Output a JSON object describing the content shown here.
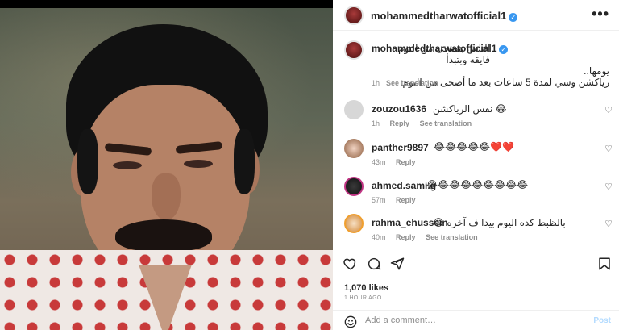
{
  "header": {
    "username": "mohammedtharwatofficial1",
    "more_label": "•••"
  },
  "caption": {
    "username": "mohammedtharwatofficial1",
    "line1": "الناس بتصحى من النوم فايقه وبتبدأ",
    "line2": "يومها..",
    "line3": "رياكشن وشي لمدة 5 ساعات بعد ما أصحى من النوم:",
    "time": "1h",
    "see_translation": "See translation"
  },
  "comments": [
    {
      "username": "zouzou1636",
      "text": "نفس الرياكشن 😂",
      "time": "1h",
      "reply": "Reply",
      "see_translation": "See translation"
    },
    {
      "username": "panther9897",
      "text": "😂😂😂😂😂❤️❤️",
      "time": "43m",
      "reply": "Reply"
    },
    {
      "username": "ahmed.sami.g",
      "text": "😂😂😂😂😂😂😂😂😂",
      "time": "57m",
      "reply": "Reply"
    },
    {
      "username": "rahma_ehussein",
      "text": "بالظبط كده اليوم بيدا ف آخره 😂",
      "time": "40m",
      "reply": "Reply",
      "see_translation": "See translation"
    }
  ],
  "likes": "1,070 likes",
  "time_ago": "1 HOUR AGO",
  "add_comment": {
    "placeholder": "Add a comment…",
    "post_label": "Post"
  },
  "icons": {
    "like": "heart-icon",
    "comment": "comment-icon",
    "share": "share-icon",
    "save": "bookmark-icon",
    "emoji": "smile-icon",
    "verified": "verified-badge-icon",
    "comment_like": "heart-icon"
  },
  "colors": {
    "verified": "#3897f0",
    "meta": "#8e8e8e",
    "post_disabled": "#b3dbff",
    "heart_emoji": "#e0245e"
  }
}
